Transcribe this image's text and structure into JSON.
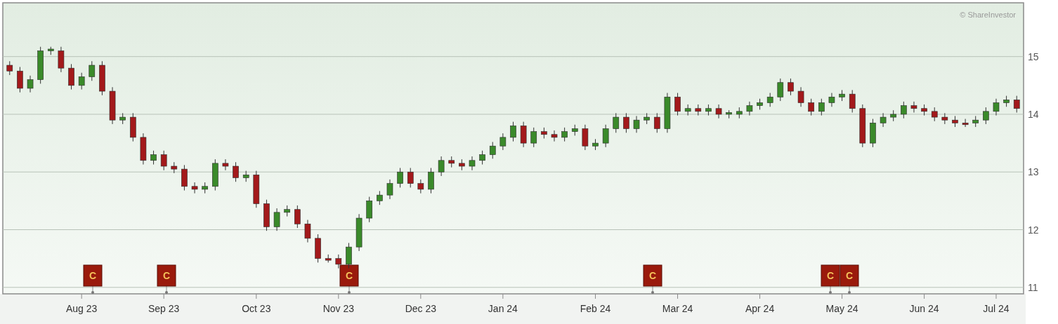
{
  "chart": {
    "credit": "© ShareInvestor",
    "chart_data": {
      "type": "candlestick",
      "grid": true,
      "ylim": [
        10.9,
        15.92
      ],
      "yticks": [
        11,
        12,
        13,
        14,
        15
      ],
      "categories": [
        null,
        null,
        null,
        null,
        null,
        null,
        null,
        "Aug 23",
        null,
        null,
        null,
        null,
        null,
        null,
        null,
        "Sep 23",
        null,
        null,
        null,
        null,
        null,
        null,
        null,
        null,
        "Oct 23",
        null,
        null,
        null,
        null,
        null,
        null,
        null,
        "Nov 23",
        null,
        null,
        null,
        null,
        null,
        null,
        null,
        "Dec 23",
        null,
        null,
        null,
        null,
        null,
        null,
        null,
        "Jan 24",
        null,
        null,
        null,
        null,
        null,
        null,
        null,
        null,
        "Feb 24",
        null,
        null,
        null,
        null,
        null,
        null,
        null,
        "Mar 24",
        null,
        null,
        null,
        null,
        null,
        null,
        null,
        "Apr 24",
        null,
        null,
        null,
        null,
        null,
        null,
        null,
        "May 24",
        null,
        null,
        null,
        null,
        null,
        null,
        null,
        "Jun 24",
        null,
        null,
        null,
        null,
        null,
        null,
        "Jul 24",
        null,
        null
      ],
      "ohlc": [
        [
          14.85,
          14.92,
          14.68,
          14.75
        ],
        [
          14.75,
          14.82,
          14.38,
          14.45
        ],
        [
          14.45,
          14.67,
          14.38,
          14.6
        ],
        [
          14.6,
          15.17,
          14.53,
          15.1
        ],
        [
          15.1,
          15.17,
          15.03,
          15.13
        ],
        [
          15.1,
          15.17,
          14.73,
          14.8
        ],
        [
          14.8,
          14.87,
          14.43,
          14.5
        ],
        [
          14.5,
          14.72,
          14.43,
          14.65
        ],
        [
          14.65,
          14.92,
          14.58,
          14.85
        ],
        [
          14.85,
          14.92,
          14.33,
          14.4
        ],
        [
          14.4,
          14.47,
          13.83,
          13.9
        ],
        [
          13.9,
          14.02,
          13.83,
          13.95
        ],
        [
          13.95,
          14.02,
          13.53,
          13.6
        ],
        [
          13.6,
          13.67,
          13.13,
          13.2
        ],
        [
          13.2,
          13.37,
          13.13,
          13.3
        ],
        [
          13.3,
          13.37,
          13.03,
          13.1
        ],
        [
          13.1,
          13.17,
          12.98,
          13.05
        ],
        [
          13.05,
          13.12,
          12.68,
          12.75
        ],
        [
          12.75,
          12.82,
          12.63,
          12.7
        ],
        [
          12.7,
          12.82,
          12.63,
          12.75
        ],
        [
          12.75,
          13.22,
          12.68,
          13.15
        ],
        [
          13.15,
          13.22,
          13.03,
          13.1
        ],
        [
          13.1,
          13.17,
          12.83,
          12.9
        ],
        [
          12.9,
          13.02,
          12.83,
          12.95
        ],
        [
          12.95,
          13.02,
          12.38,
          12.45
        ],
        [
          12.45,
          12.52,
          11.98,
          12.05
        ],
        [
          12.05,
          12.37,
          11.98,
          12.3
        ],
        [
          12.3,
          12.42,
          12.23,
          12.35
        ],
        [
          12.35,
          12.42,
          12.03,
          12.1
        ],
        [
          12.1,
          12.17,
          11.78,
          11.85
        ],
        [
          11.85,
          11.92,
          11.43,
          11.5
        ],
        [
          11.5,
          11.57,
          11.43,
          11.47
        ],
        [
          11.5,
          11.57,
          11.33,
          11.4
        ],
        [
          11.4,
          11.77,
          11.33,
          11.7
        ],
        [
          11.7,
          12.27,
          11.63,
          12.2
        ],
        [
          12.2,
          12.57,
          12.13,
          12.5
        ],
        [
          12.5,
          12.67,
          12.43,
          12.6
        ],
        [
          12.6,
          12.87,
          12.53,
          12.8
        ],
        [
          12.8,
          13.07,
          12.73,
          13.0
        ],
        [
          13.0,
          13.07,
          12.73,
          12.8
        ],
        [
          12.8,
          12.87,
          12.63,
          12.7
        ],
        [
          12.7,
          13.07,
          12.63,
          13.0
        ],
        [
          13.0,
          13.27,
          12.93,
          13.2
        ],
        [
          13.2,
          13.27,
          13.08,
          13.15
        ],
        [
          13.15,
          13.22,
          13.03,
          13.1
        ],
        [
          13.1,
          13.27,
          13.03,
          13.2
        ],
        [
          13.2,
          13.37,
          13.13,
          13.3
        ],
        [
          13.3,
          13.52,
          13.23,
          13.45
        ],
        [
          13.45,
          13.67,
          13.38,
          13.6
        ],
        [
          13.6,
          13.87,
          13.53,
          13.8
        ],
        [
          13.8,
          13.87,
          13.43,
          13.5
        ],
        [
          13.5,
          13.77,
          13.43,
          13.7
        ],
        [
          13.7,
          13.77,
          13.58,
          13.65
        ],
        [
          13.65,
          13.72,
          13.53,
          13.6
        ],
        [
          13.6,
          13.77,
          13.53,
          13.7
        ],
        [
          13.7,
          13.82,
          13.63,
          13.75
        ],
        [
          13.75,
          13.82,
          13.38,
          13.45
        ],
        [
          13.45,
          13.57,
          13.38,
          13.5
        ],
        [
          13.5,
          13.82,
          13.43,
          13.75
        ],
        [
          13.75,
          14.02,
          13.68,
          13.95
        ],
        [
          13.95,
          14.02,
          13.68,
          13.75
        ],
        [
          13.75,
          13.97,
          13.68,
          13.9
        ],
        [
          13.9,
          14.02,
          13.83,
          13.95
        ],
        [
          13.95,
          14.02,
          13.68,
          13.75
        ],
        [
          13.75,
          14.37,
          13.68,
          14.3
        ],
        [
          14.3,
          14.37,
          13.98,
          14.05
        ],
        [
          14.05,
          14.17,
          13.98,
          14.1
        ],
        [
          14.1,
          14.17,
          13.98,
          14.05
        ],
        [
          14.05,
          14.17,
          13.98,
          14.1
        ],
        [
          14.1,
          14.17,
          13.93,
          14.0
        ],
        [
          14.0,
          14.07,
          13.93,
          14.03
        ],
        [
          14.0,
          14.12,
          13.93,
          14.05
        ],
        [
          14.05,
          14.22,
          13.98,
          14.15
        ],
        [
          14.15,
          14.27,
          14.08,
          14.2
        ],
        [
          14.2,
          14.37,
          14.13,
          14.3
        ],
        [
          14.3,
          14.62,
          14.23,
          14.55
        ],
        [
          14.55,
          14.62,
          14.33,
          14.4
        ],
        [
          14.4,
          14.47,
          14.13,
          14.2
        ],
        [
          14.2,
          14.27,
          13.98,
          14.05
        ],
        [
          14.05,
          14.27,
          13.98,
          14.2
        ],
        [
          14.2,
          14.37,
          14.13,
          14.3
        ],
        [
          14.3,
          14.42,
          14.23,
          14.35
        ],
        [
          14.35,
          14.42,
          14.03,
          14.1
        ],
        [
          14.1,
          14.17,
          13.43,
          13.5
        ],
        [
          13.5,
          13.92,
          13.43,
          13.85
        ],
        [
          13.85,
          14.02,
          13.78,
          13.95
        ],
        [
          13.95,
          14.07,
          13.88,
          14.0
        ],
        [
          14.0,
          14.22,
          13.93,
          14.15
        ],
        [
          14.15,
          14.22,
          14.03,
          14.1
        ],
        [
          14.1,
          14.17,
          13.98,
          14.05
        ],
        [
          14.05,
          14.12,
          13.88,
          13.95
        ],
        [
          13.95,
          14.02,
          13.83,
          13.9
        ],
        [
          13.9,
          13.97,
          13.78,
          13.85
        ],
        [
          13.85,
          13.92,
          13.78,
          13.82
        ],
        [
          13.85,
          13.97,
          13.78,
          13.9
        ],
        [
          13.9,
          14.12,
          13.83,
          14.05
        ],
        [
          14.05,
          14.27,
          13.98,
          14.2
        ],
        [
          14.2,
          14.32,
          14.13,
          14.25
        ],
        [
          14.25,
          14.32,
          14.03,
          14.1
        ]
      ]
    },
    "event_markers": [
      {
        "text": "C"
      },
      {
        "text": "C"
      },
      {
        "text": "C"
      },
      {
        "text": "C"
      },
      {
        "text": "C"
      },
      {
        "text": "C"
      }
    ]
  }
}
